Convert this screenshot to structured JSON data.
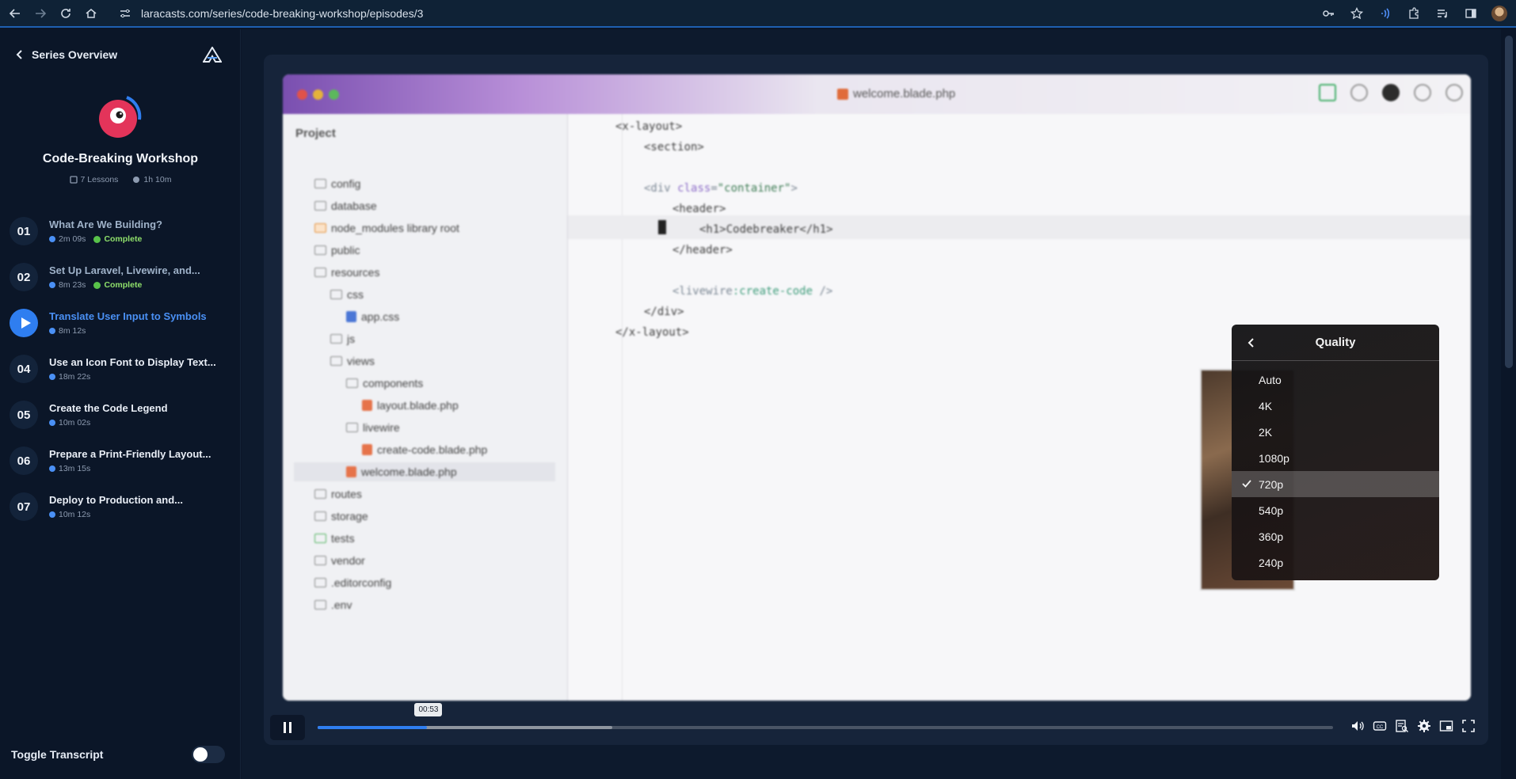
{
  "browser": {
    "url": "laracasts.com/series/code-breaking-workshop/episodes/3"
  },
  "sidebar": {
    "back_label": "Series Overview",
    "series_title": "Code-Breaking Workshop",
    "lessons_count": "7 Lessons",
    "total_duration": "1h 10m",
    "lessons": [
      {
        "num": "01",
        "title": "What Are We Building?",
        "duration": "2m 09s",
        "status": "Complete"
      },
      {
        "num": "02",
        "title": "Set Up Laravel, Livewire, and...",
        "duration": "8m 23s",
        "status": "Complete"
      },
      {
        "num": "03",
        "title": "Translate User Input to Symbols",
        "duration": "8m 12s",
        "status": ""
      },
      {
        "num": "04",
        "title": "Use an Icon Font to Display Text...",
        "duration": "18m 22s",
        "status": ""
      },
      {
        "num": "05",
        "title": "Create the Code Legend",
        "duration": "10m 02s",
        "status": ""
      },
      {
        "num": "06",
        "title": "Prepare a Print-Friendly Layout...",
        "duration": "13m 15s",
        "status": ""
      },
      {
        "num": "07",
        "title": "Deploy to Production and...",
        "duration": "10m 12s",
        "status": ""
      }
    ],
    "transcript_label": "Toggle Transcript"
  },
  "ide": {
    "file_title": "welcome.blade.php",
    "project_label": "Project",
    "tree": [
      "config",
      "database",
      "node_modules  library root",
      "public",
      "resources",
      "css",
      "app.css",
      "js",
      "views",
      "components",
      "layout.blade.php",
      "livewire",
      "create-code.blade.php",
      "welcome.blade.php",
      "routes",
      "storage",
      "tests",
      "vendor",
      ".editorconfig",
      ".env"
    ],
    "code": {
      "l1": "<x-layout>",
      "l2": "<section>",
      "l3a": "<div ",
      "l3b": "class",
      "l3c": "=",
      "l3d": "\"container\"",
      "l3e": ">",
      "l4": "<header>",
      "l5": "<h1>Codebreaker</h1>",
      "l6": "</header>",
      "l7a": "<livewire",
      "l7b": ":create-code",
      "l7c": " />",
      "l8": "</div>",
      "l9": "</x-layout>"
    }
  },
  "quality_menu": {
    "title": "Quality",
    "options": [
      "Auto",
      "4K",
      "2K",
      "1080p",
      "720p",
      "540p",
      "360p",
      "240p"
    ],
    "selected": "720p"
  },
  "player": {
    "current_time": "00:53",
    "progress": 0.108,
    "buffered": 0.29
  },
  "colors": {
    "accent": "#2f7ef0",
    "complete": "#8fe06b",
    "background": "#0b1628"
  }
}
